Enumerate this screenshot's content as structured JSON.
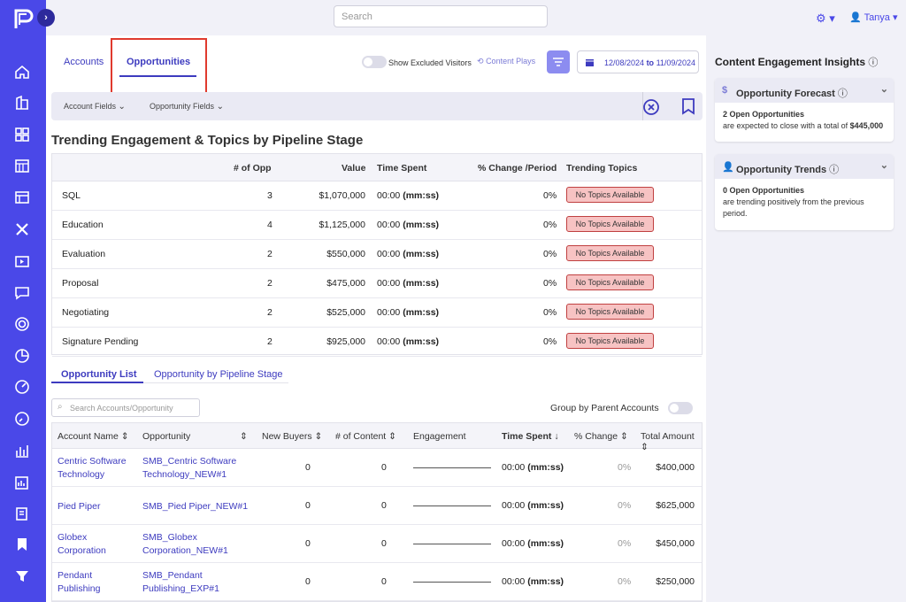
{
  "topbar": {
    "search_placeholder": "Search",
    "user": "Tanya"
  },
  "tabs": {
    "accounts": "Accounts",
    "opportunities": "Opportunities"
  },
  "toolbar": {
    "show_excluded": "Show Excluded Visitors",
    "content_plays": "Content Plays",
    "date_from": "12/08/2024",
    "date_to_word": "to",
    "date_to": "11/09/2024"
  },
  "fields": {
    "account": "Account Fields",
    "opportunity": "Opportunity Fields"
  },
  "trending": {
    "title": "Trending Engagement & Topics by Pipeline Stage",
    "headers": [
      "",
      "# of Opp",
      "Value",
      "Time Spent",
      "% Change /Period",
      "Trending Topics"
    ],
    "rows": [
      {
        "stage": "SQL",
        "opp": "3",
        "value": "$1,070,000",
        "time": "00:00",
        "unit": "(mm:ss)",
        "change": "0%",
        "topics": "No Topics Available"
      },
      {
        "stage": "Education",
        "opp": "4",
        "value": "$1,125,000",
        "time": "00:00",
        "unit": "(mm:ss)",
        "change": "0%",
        "topics": "No Topics Available"
      },
      {
        "stage": "Evaluation",
        "opp": "2",
        "value": "$550,000",
        "time": "00:00",
        "unit": "(mm:ss)",
        "change": "0%",
        "topics": "No Topics Available"
      },
      {
        "stage": "Proposal",
        "opp": "2",
        "value": "$475,000",
        "time": "00:00",
        "unit": "(mm:ss)",
        "change": "0%",
        "topics": "No Topics Available"
      },
      {
        "stage": "Negotiating",
        "opp": "2",
        "value": "$525,000",
        "time": "00:00",
        "unit": "(mm:ss)",
        "change": "0%",
        "topics": "No Topics Available"
      },
      {
        "stage": "Signature Pending",
        "opp": "2",
        "value": "$925,000",
        "time": "00:00",
        "unit": "(mm:ss)",
        "change": "0%",
        "topics": "No Topics Available"
      }
    ]
  },
  "list": {
    "tab1": "Opportunity List",
    "tab2": "Opportunity by Pipeline Stage",
    "search_placeholder": "Search Accounts/Opportunity",
    "group_label": "Group by Parent Accounts",
    "headers": [
      "Account Name",
      "Opportunity",
      "New Buyers",
      "# of Content",
      "Engagement",
      "Time Spent",
      "% Change",
      "Total Amount"
    ],
    "rows": [
      {
        "account1": "Centric Software",
        "account2": "Technology",
        "opp1": "SMB_Centric Software",
        "opp2": "Technology_NEW#1",
        "buyers": "0",
        "content": "0",
        "time": "00:00",
        "unit": "(mm:ss)",
        "change": "0%",
        "amount": "$400,000"
      },
      {
        "account1": "Pied Piper",
        "account2": "",
        "opp1": "SMB_Pied Piper_NEW#1",
        "opp2": "",
        "buyers": "0",
        "content": "0",
        "time": "00:00",
        "unit": "(mm:ss)",
        "change": "0%",
        "amount": "$625,000"
      },
      {
        "account1": "Globex",
        "account2": "Corporation",
        "opp1": "SMB_Globex",
        "opp2": "Corporation_NEW#1",
        "buyers": "0",
        "content": "0",
        "time": "00:00",
        "unit": "(mm:ss)",
        "change": "0%",
        "amount": "$450,000"
      },
      {
        "account1": "Pendant",
        "account2": "Publishing",
        "opp1": "SMB_Pendant",
        "opp2": "Publishing_EXP#1",
        "buyers": "0",
        "content": "0",
        "time": "00:00",
        "unit": "(mm:ss)",
        "change": "0%",
        "amount": "$250,000"
      }
    ]
  },
  "insights": {
    "title": "Content Engagement Insights",
    "forecast": {
      "title": "Opportunity Forecast",
      "bold": "2 Open Opportunities",
      "text": "are expected to close with a total of",
      "amount": "$445,000"
    },
    "trends": {
      "title": "Opportunity Trends",
      "bold": "0 Open Opportunities",
      "text": "are trending positively from the previous period."
    }
  }
}
